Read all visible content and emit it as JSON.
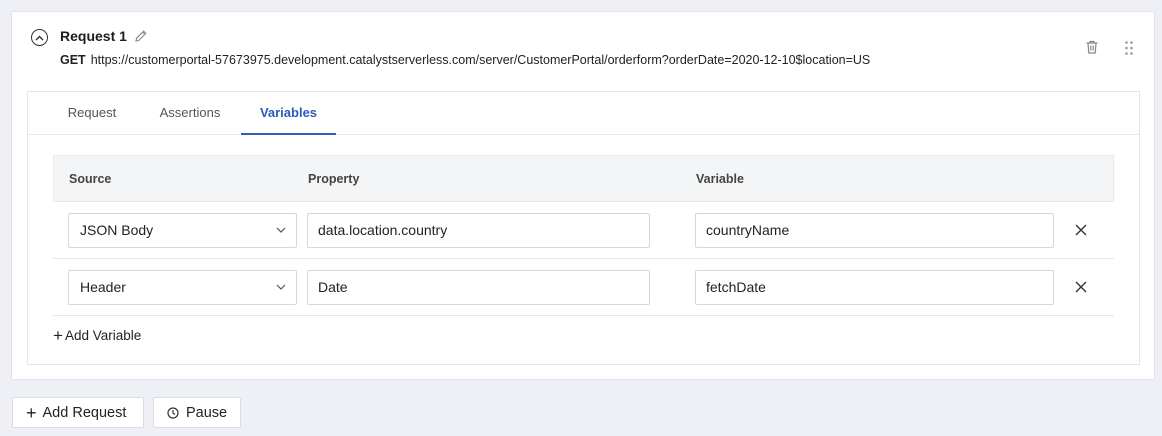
{
  "request": {
    "title": "Request 1",
    "method": "GET",
    "url": "https://customerportal-57673975.development.catalystserverless.com/server/CustomerPortal/orderform?orderDate=2020-12-10$location=US"
  },
  "tabs": [
    {
      "label": "Request"
    },
    {
      "label": "Assertions"
    },
    {
      "label": "Variables",
      "active": true
    }
  ],
  "table": {
    "headers": {
      "source": "Source",
      "property": "Property",
      "variable": "Variable"
    },
    "rows": [
      {
        "source": "JSON Body",
        "property": "data.location.country",
        "variable": "countryName"
      },
      {
        "source": "Header",
        "property": "Date",
        "variable": "fetchDate"
      }
    ]
  },
  "add_variable_label": "Add Variable",
  "buttons": {
    "add_request": "Add Request",
    "pause": "Pause"
  },
  "colors": {
    "accent": "#2f5fc2",
    "background": "#eef0f5"
  }
}
